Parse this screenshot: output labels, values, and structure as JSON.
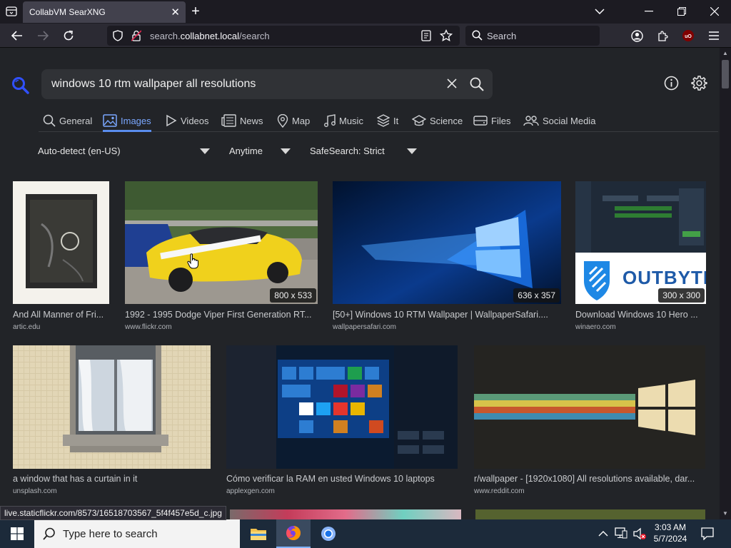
{
  "browser": {
    "tab_title": "CollabVM SearXNG",
    "url_domain": "collabnet.local",
    "url_prefix": "search.",
    "url_path": "/search",
    "search_placeholder": "Search"
  },
  "search": {
    "query": "windows 10 rtm wallpaper all resolutions"
  },
  "categories": [
    {
      "label": "General",
      "icon": "search-icon"
    },
    {
      "label": "Images",
      "icon": "image-icon",
      "active": true
    },
    {
      "label": "Videos",
      "icon": "play-icon"
    },
    {
      "label": "News",
      "icon": "newspaper-icon"
    },
    {
      "label": "Map",
      "icon": "map-pin-icon"
    },
    {
      "label": "Music",
      "icon": "music-icon"
    },
    {
      "label": "It",
      "icon": "layers-icon"
    },
    {
      "label": "Science",
      "icon": "graduation-cap-icon"
    },
    {
      "label": "Files",
      "icon": "drive-icon"
    },
    {
      "label": "Social Media",
      "icon": "people-icon"
    }
  ],
  "filters": {
    "language": "Auto-detect (en-US)",
    "time": "Anytime",
    "safesearch": "SafeSearch: Strict"
  },
  "results": [
    {
      "title": "And All Manner of Fri...",
      "source": "artic.edu",
      "dims": ""
    },
    {
      "title": "1992 - 1995 Dodge Viper First Generation RT...",
      "source": "www.flickr.com",
      "dims": "800 x 533"
    },
    {
      "title": "[50+] Windows 10 RTM Wallpaper | WallpaperSafari....",
      "source": "wallpapersafari.com",
      "dims": "636 x 357"
    },
    {
      "title": "Download Windows 10 Hero ...",
      "source": "winaero.com",
      "dims": "300 x 300"
    },
    {
      "title": "a window that has a curtain in it",
      "source": "unsplash.com",
      "dims": ""
    },
    {
      "title": "Cómo verificar la RAM en usted Windows 10 laptops",
      "source": "applexgen.com",
      "dims": ""
    },
    {
      "title": "r/wallpaper - [1920x1080] All resolutions available, dar...",
      "source": "www.reddit.com",
      "dims": ""
    }
  ],
  "thumb_text": {
    "outbyte": "OUTBYTE"
  },
  "status_url": "live.staticflickr.com/8573/16518703567_5f4f457e5d_c.jpg",
  "taskbar": {
    "search_placeholder": "Type here to search",
    "time": "3:03 AM",
    "date": "5/7/2024"
  },
  "colors": {
    "accent": "#5a8dee",
    "page_bg": "#222428",
    "query_bg": "#303236"
  }
}
